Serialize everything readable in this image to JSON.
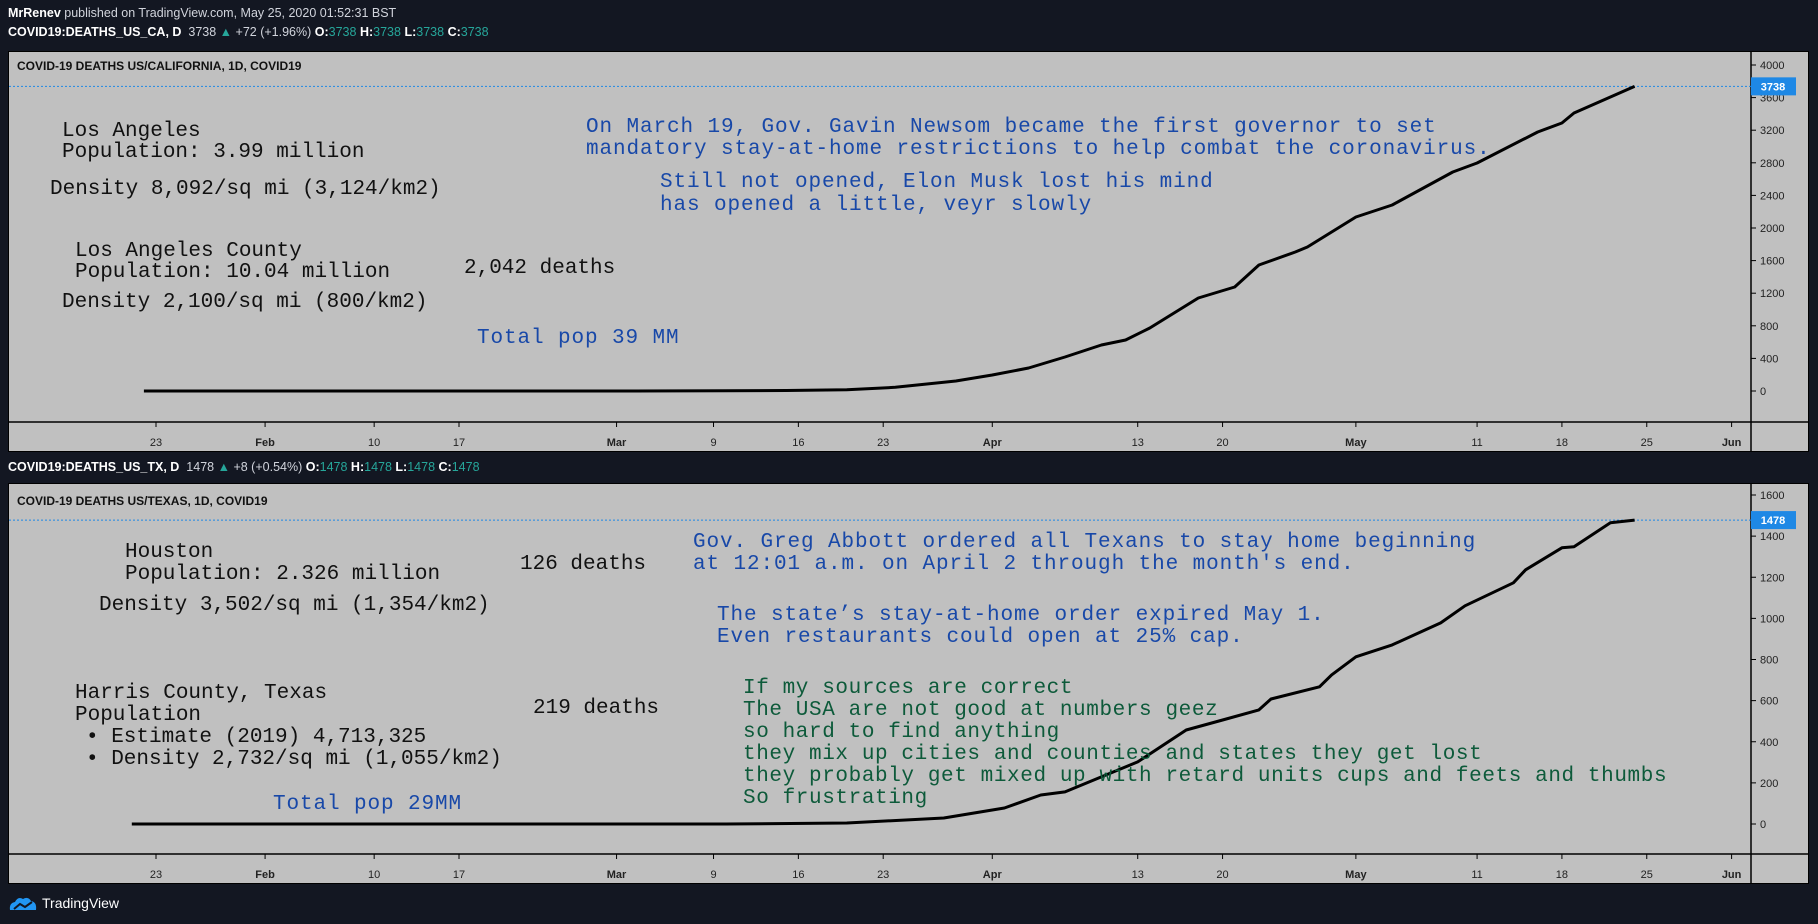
{
  "header": {
    "author": "MrRenev",
    "published": " published on TradingView.com, May 25, 2020 01:52:31 BST"
  },
  "charts": [
    {
      "symbol": "COVID19:DEATHS_US_CA, D",
      "last": "3738",
      "change": "+72 (+1.96%)",
      "o": "3738",
      "h": "3738",
      "l": "3738",
      "c": "3738",
      "title": "COVID-19 DEATHS US/CALIFORNIA, 1D, COVID19",
      "annotations": {
        "city": "Los Angeles",
        "city_pop": "Population: 3.99 million",
        "city_density": "Density 8,092/sq mi (3,124/km2)",
        "county": "Los Angeles County",
        "county_pop": "Population: 10.04 million",
        "county_deaths": "2,042 deaths",
        "county_density": "Density 2,100/sq mi (800/km2)",
        "total_pop": "Total pop 39 MM",
        "note1_l1": "On March 19, Gov. Gavin Newsom became the first governor to set",
        "note1_l2": "mandatory stay-at-home restrictions to help combat the coronavirus.",
        "note2_l1": "Still not opened, Elon Musk lost his mind",
        "note2_l2": "has opened a little, veyr slowly"
      }
    },
    {
      "symbol": "COVID19:DEATHS_US_TX, D",
      "last": "1478",
      "change": "+8 (+0.54%)",
      "o": "1478",
      "h": "1478",
      "l": "1478",
      "c": "1478",
      "title": "COVID-19 DEATHS US/TEXAS, 1D, COVID19",
      "annotations": {
        "city": "Houston",
        "city_pop": "Population: 2.326 million",
        "city_deaths": "126 deaths",
        "city_density": "Density 3,502/sq mi (1,354/km2)",
        "county": "Harris County, Texas",
        "county_pop": "Population",
        "county_est": "• Estimate (2019) 4,713,325",
        "county_density": "• Density 2,732/sq mi (1,055/km2)",
        "county_deaths": "219 deaths",
        "total_pop": "Total pop 29MM",
        "note1_l1": "Gov. Greg Abbott ordered all Texans to stay home beginning",
        "note1_l2": "at 12:01 a.m. on April 2 through the month's end.",
        "note2_l1": "The state’s stay-at-home order expired May 1.",
        "note2_l2": "Even restaurants could open at 25% cap.",
        "rant": [
          "If my sources are correct",
          "The USA are not good at numbers geez",
          "so hard to find anything",
          "they mix up cities and counties and states they get lost",
          "they probably get mixed up with retard units cups and feets and thumbs",
          "So frustrating"
        ]
      }
    }
  ],
  "chart_data": [
    {
      "type": "line",
      "title": "COVID-19 DEATHS US/CALIFORNIA, 1D, COVID19",
      "ylim": [
        0,
        4000
      ],
      "yticks": [
        0,
        400,
        800,
        1200,
        1600,
        2000,
        2400,
        2800,
        3200,
        3600,
        4000
      ],
      "xticks": [
        [
          "2020-01-23",
          "23"
        ],
        [
          "2020-02-01",
          "Feb"
        ],
        [
          "2020-02-10",
          "10"
        ],
        [
          "2020-02-17",
          "17"
        ],
        [
          "2020-03-01",
          "Mar"
        ],
        [
          "2020-03-09",
          "9"
        ],
        [
          "2020-03-16",
          "16"
        ],
        [
          "2020-03-23",
          "23"
        ],
        [
          "2020-04-01",
          "Apr"
        ],
        [
          "2020-04-13",
          "13"
        ],
        [
          "2020-04-20",
          "20"
        ],
        [
          "2020-05-01",
          "May"
        ],
        [
          "2020-05-11",
          "11"
        ],
        [
          "2020-05-18",
          "18"
        ],
        [
          "2020-05-25",
          "25"
        ],
        [
          "2020-06-01",
          "Jun"
        ]
      ],
      "last_value": 3738,
      "series": [
        {
          "points": [
            [
              "2020-01-22",
              0
            ],
            [
              "2020-03-01",
              0
            ],
            [
              "2020-03-10",
              2
            ],
            [
              "2020-03-15",
              6
            ],
            [
              "2020-03-20",
              15
            ],
            [
              "2020-03-24",
              45
            ],
            [
              "2020-03-29",
              123
            ],
            [
              "2020-04-01",
              196
            ],
            [
              "2020-04-04",
              282
            ],
            [
              "2020-04-07",
              417
            ],
            [
              "2020-04-10",
              564
            ],
            [
              "2020-04-12",
              626
            ],
            [
              "2020-04-14",
              773
            ],
            [
              "2020-04-18",
              1141
            ],
            [
              "2020-04-21",
              1276
            ],
            [
              "2020-04-23",
              1546
            ],
            [
              "2020-04-26",
              1705
            ],
            [
              "2020-04-27",
              1767
            ],
            [
              "2020-05-01",
              2135
            ],
            [
              "2020-05-04",
              2282
            ],
            [
              "2020-05-09",
              2687
            ],
            [
              "2020-05-11",
              2797
            ],
            [
              "2020-05-16",
              3178
            ],
            [
              "2020-05-18",
              3288
            ],
            [
              "2020-05-19",
              3411
            ],
            [
              "2020-05-24",
              3738
            ]
          ]
        }
      ],
      "colors": {
        "line": "#000000",
        "last_label": "#1e88e5"
      }
    },
    {
      "type": "line",
      "title": "COVID-19 DEATHS US/TEXAS, 1D, COVID19",
      "ylim": [
        0,
        1600
      ],
      "yticks": [
        0,
        200,
        400,
        600,
        800,
        1000,
        1200,
        1400,
        1600
      ],
      "xticks": [
        [
          "2020-01-23",
          "23"
        ],
        [
          "2020-02-01",
          "Feb"
        ],
        [
          "2020-02-10",
          "10"
        ],
        [
          "2020-02-17",
          "17"
        ],
        [
          "2020-03-01",
          "Mar"
        ],
        [
          "2020-03-09",
          "9"
        ],
        [
          "2020-03-16",
          "16"
        ],
        [
          "2020-03-23",
          "23"
        ],
        [
          "2020-04-01",
          "Apr"
        ],
        [
          "2020-04-13",
          "13"
        ],
        [
          "2020-04-20",
          "20"
        ],
        [
          "2020-05-01",
          "May"
        ],
        [
          "2020-05-11",
          "11"
        ],
        [
          "2020-05-18",
          "18"
        ],
        [
          "2020-05-25",
          "25"
        ],
        [
          "2020-06-01",
          "Jun"
        ]
      ],
      "last_value": 1478,
      "series": [
        {
          "points": [
            [
              "2020-01-21",
              0
            ],
            [
              "2020-03-10",
              0
            ],
            [
              "2020-03-20",
              5
            ],
            [
              "2020-03-28",
              29
            ],
            [
              "2020-04-02",
              78
            ],
            [
              "2020-04-05",
              141
            ],
            [
              "2020-04-07",
              156
            ],
            [
              "2020-04-13",
              302
            ],
            [
              "2020-04-17",
              457
            ],
            [
              "2020-04-20",
              506
            ],
            [
              "2020-04-23",
              555
            ],
            [
              "2020-04-24",
              608
            ],
            [
              "2020-04-28",
              667
            ],
            [
              "2020-04-29",
              725
            ],
            [
              "2020-05-01",
              813
            ],
            [
              "2020-05-04",
              871
            ],
            [
              "2020-05-08",
              978
            ],
            [
              "2020-05-10",
              1061
            ],
            [
              "2020-05-14",
              1173
            ],
            [
              "2020-05-15",
              1236
            ],
            [
              "2020-05-18",
              1343
            ],
            [
              "2020-05-19",
              1348
            ],
            [
              "2020-05-22",
              1465
            ],
            [
              "2020-05-24",
              1478
            ]
          ]
        }
      ],
      "colors": {
        "line": "#000000",
        "last_label": "#1e88e5"
      }
    }
  ],
  "footer": {
    "brand": "TradingView",
    "brand_color": "#2196f3"
  }
}
